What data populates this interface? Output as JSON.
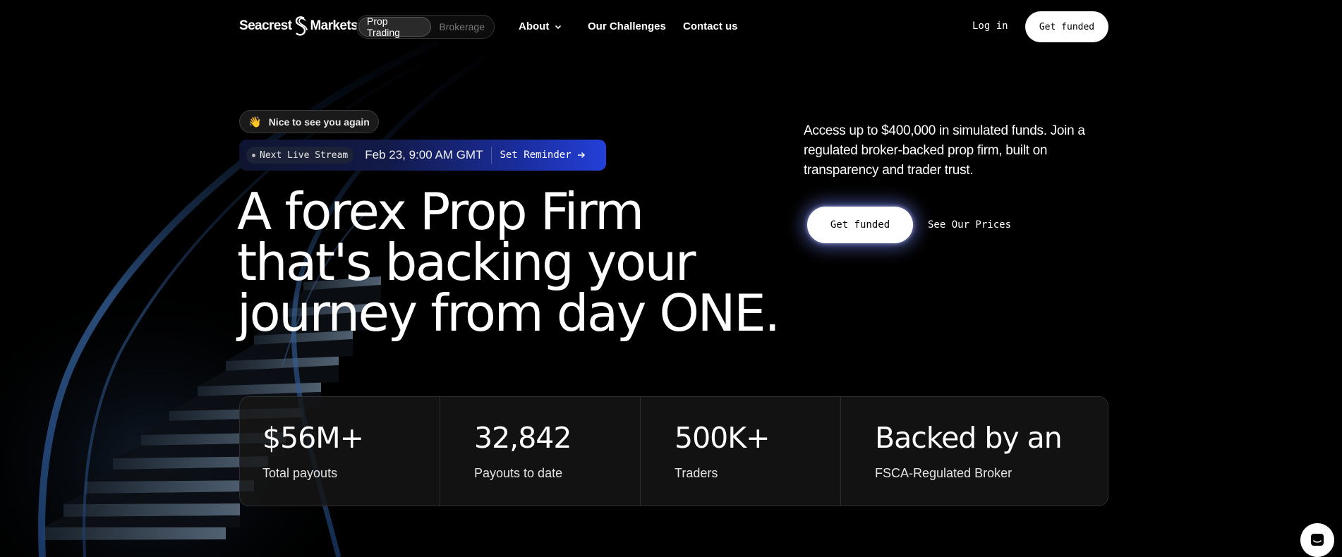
{
  "brand": {
    "name_left": "Seacrest",
    "name_right": "Markets",
    "logo_icon": "seacrest-s-logo"
  },
  "segment": {
    "items": [
      {
        "label": "Prop Trading",
        "active": true
      },
      {
        "label": "Brokerage",
        "active": false
      }
    ]
  },
  "nav": {
    "about": "About",
    "challenges": "Our Challenges",
    "contact": "Contact us",
    "login": "Log in",
    "cta": "Get funded"
  },
  "hero": {
    "greeting": "Nice to see you again",
    "greeting_icon": "waving-hand",
    "live": {
      "label": "Next Live Stream",
      "date": "Feb 23, 9:00 AM GMT",
      "cta": "Set Reminder"
    },
    "headline": [
      "A forex Prop Firm",
      "that's backing your",
      "journey from day ONE."
    ],
    "tagline": "Access up to $400,000 in simulated funds. Join a regulated broker-backed prop firm, built on transparency and trader trust.",
    "primary_cta": "Get funded",
    "secondary_cta": "See Our Prices"
  },
  "stats": [
    {
      "value": "$56M+",
      "label": "Total payouts"
    },
    {
      "value": "32,842",
      "label": "Payouts to date"
    },
    {
      "value": "500K+",
      "label": "Traders"
    },
    {
      "value": "Backed by an",
      "label": "FSCA-Regulated Broker"
    }
  ],
  "colors": {
    "background": "#000000",
    "accent_blue": "#2340d8",
    "text": "#ffffff"
  },
  "chat": {
    "icon": "chat-bubble-icon"
  }
}
